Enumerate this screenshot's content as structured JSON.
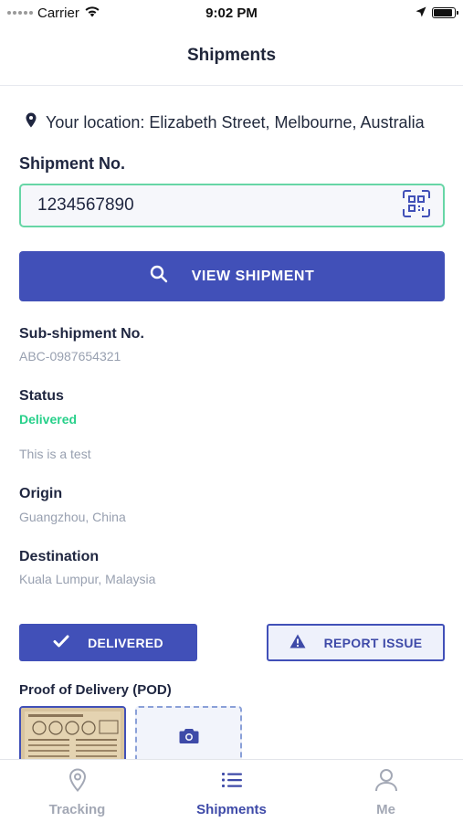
{
  "status_bar": {
    "carrier": "Carrier",
    "time": "9:02 PM",
    "battery_level": 0.9
  },
  "header": {
    "title": "Shipments"
  },
  "location": {
    "text": "Your location: Elizabeth Street, Melbourne, Australia",
    "icon": "map-pin-icon"
  },
  "shipment_search": {
    "label": "Shipment No.",
    "value": "1234567890",
    "qr_icon": "qr-code-icon",
    "button_label": "VIEW SHIPMENT",
    "button_icon": "search-icon"
  },
  "details": {
    "sub_shipment_label": "Sub-shipment No.",
    "sub_shipment_value": "ABC-0987654321",
    "status_label": "Status",
    "status_value": "Delivered",
    "note": "This is a test",
    "origin_label": "Origin",
    "origin_value": "Guangzhou, China",
    "destination_label": "Destination",
    "destination_value": "Kuala Lumpur, Malaysia"
  },
  "actions": {
    "delivered_label": "DELIVERED",
    "report_label": "REPORT ISSUE"
  },
  "pod": {
    "label": "Proof of Delivery (POD)"
  },
  "tabs": [
    {
      "label": "Tracking",
      "icon": "map-pin-icon",
      "active": false
    },
    {
      "label": "Shipments",
      "icon": "list-icon",
      "active": true
    },
    {
      "label": "Me",
      "icon": "user-icon",
      "active": false
    }
  ],
  "colors": {
    "primary": "#4150b8",
    "success": "#27d08a",
    "input_border": "#67d6a6",
    "muted": "#98a0b0"
  }
}
